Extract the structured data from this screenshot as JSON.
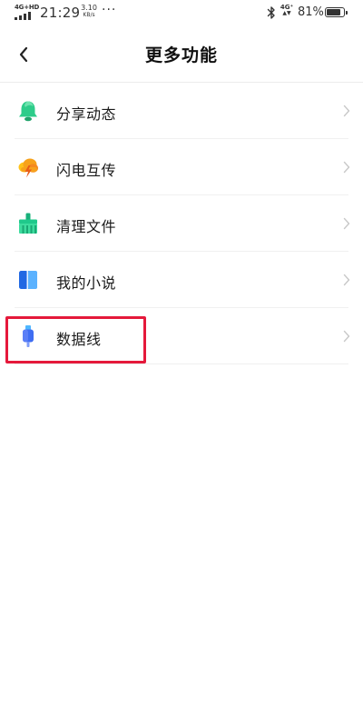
{
  "status_bar": {
    "network": "4G+HD",
    "time": "21:29",
    "speed_value": "3.10",
    "speed_unit": "KB/s",
    "more": "···",
    "mobile_data": "4G⁺",
    "battery_percent": "81%",
    "battery_level": 0.81
  },
  "header": {
    "title": "更多功能"
  },
  "menu": {
    "items": [
      {
        "label": "分享动态",
        "icon": "bell-icon",
        "color": "#2ecc8a"
      },
      {
        "label": "闪电互传",
        "icon": "cloud-lightning-icon",
        "color": "#f7a21b"
      },
      {
        "label": "清理文件",
        "icon": "broom-icon",
        "color": "#1fc98b"
      },
      {
        "label": "我的小说",
        "icon": "book-icon",
        "color": "#3a8cf5"
      },
      {
        "label": "数据线",
        "icon": "usb-cable-icon",
        "color": "#3f6df2"
      }
    ]
  },
  "colors": {
    "highlight": "#e5193b",
    "chevron": "#c8c8c8"
  }
}
